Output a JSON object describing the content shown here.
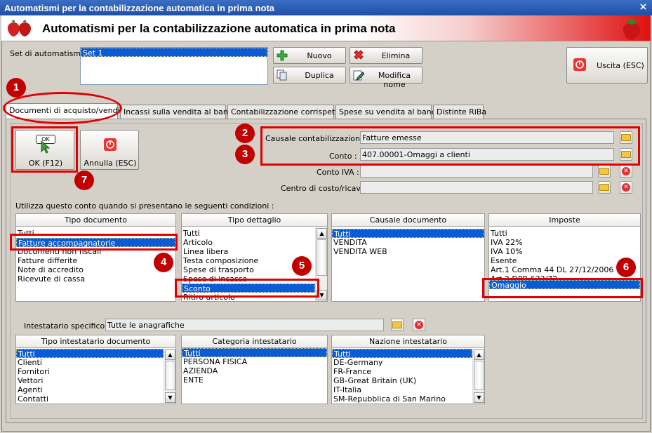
{
  "window": {
    "title": "Automatismi per la contabilizzazione automatica in prima nota",
    "close": "×"
  },
  "header": {
    "title": "Automatismi per la contabilizzazione automatica in prima nota"
  },
  "set": {
    "label": "Set di automatismi :",
    "items": [
      "Set 1"
    ]
  },
  "toolbar": {
    "nuovo": "Nuovo",
    "elimina": "Elimina",
    "duplica": "Duplica",
    "modifica": "Modifica nome",
    "uscita": "Uscita (ESC)"
  },
  "tabs": [
    "Documenti di acquisto/vendita",
    "Incassi sulla vendita al banco",
    "Contabilizzazione corrispettivi",
    "Spese su vendita al banco",
    "Distinte RiBa"
  ],
  "actions": {
    "ok": "OK (F12)",
    "ok_icon_text": "OK",
    "annulla": "Annulla (ESC)"
  },
  "fields": {
    "causale_label": "Causale contabilizzazione :",
    "causale_value": "Fatture emesse",
    "conto_label": "Conto :",
    "conto_value": "407.00001-Omaggi a clienti",
    "conto_iva_label": "Conto IVA :",
    "conto_iva_value": "",
    "centro_label": "Centro di costo/ricavo",
    "centro_value": ""
  },
  "conditions_label": "Utilizza questo conto quando si presentano le seguenti condizioni :",
  "lists": {
    "tipo_documento": {
      "header": "Tipo documento",
      "items": [
        "Tutti",
        "Fatture accompagnatorie",
        "Documenti non fiscali",
        "Fatture differite",
        "Note di accredito",
        "Ricevute di cassa"
      ],
      "selected": 1
    },
    "tipo_dettaglio": {
      "header": "Tipo dettaglio",
      "items": [
        "Tutti",
        "Articolo",
        "Linea libera",
        "Testa composizione",
        "Spese di trasporto",
        "Spese di incasso",
        "Sconto",
        "Ritiro articolo"
      ],
      "selected": 6
    },
    "causale_documento": {
      "header": "Causale documento",
      "items": [
        "Tutti",
        "VENDITA",
        "VENDITA WEB"
      ],
      "selected": 0
    },
    "imposte": {
      "header": "Imposte",
      "items": [
        "Tutti",
        "IVA 22%",
        "IVA 10%",
        "Esente",
        "Art.1 Comma 44 DL 27/12/2006",
        "Art.2 DPR 633/72",
        "Omaggio"
      ],
      "selected": 6
    }
  },
  "intestatario": {
    "label": "Intestatario specifico :",
    "value": "Tutte le anagrafiche"
  },
  "lists2": {
    "tipo_intestatario": {
      "header": "Tipo intestatario documento",
      "items": [
        "Tutti",
        "Clienti",
        "Fornitori",
        "Vettori",
        "Agenti",
        "Contatti"
      ],
      "selected": 0
    },
    "categoria": {
      "header": "Categoria intestatario",
      "items": [
        "Tutti",
        "PERSONA FISICA",
        "AZIENDA",
        "ENTE"
      ],
      "selected": 0
    },
    "nazione": {
      "header": "Nazione intestatario",
      "items": [
        "Tutti",
        "DE-Germany",
        "FR-France",
        "GB-Great Britain (UK)",
        "IT-Italia",
        "SM-Repubblica di San Marino"
      ],
      "selected": 0
    }
  },
  "markers": [
    "1",
    "2",
    "3",
    "4",
    "5",
    "6",
    "7"
  ],
  "colors": {
    "accent_red": "#e00000",
    "selection": "#0a5bd6",
    "title_blue": "#1f4fa8"
  }
}
